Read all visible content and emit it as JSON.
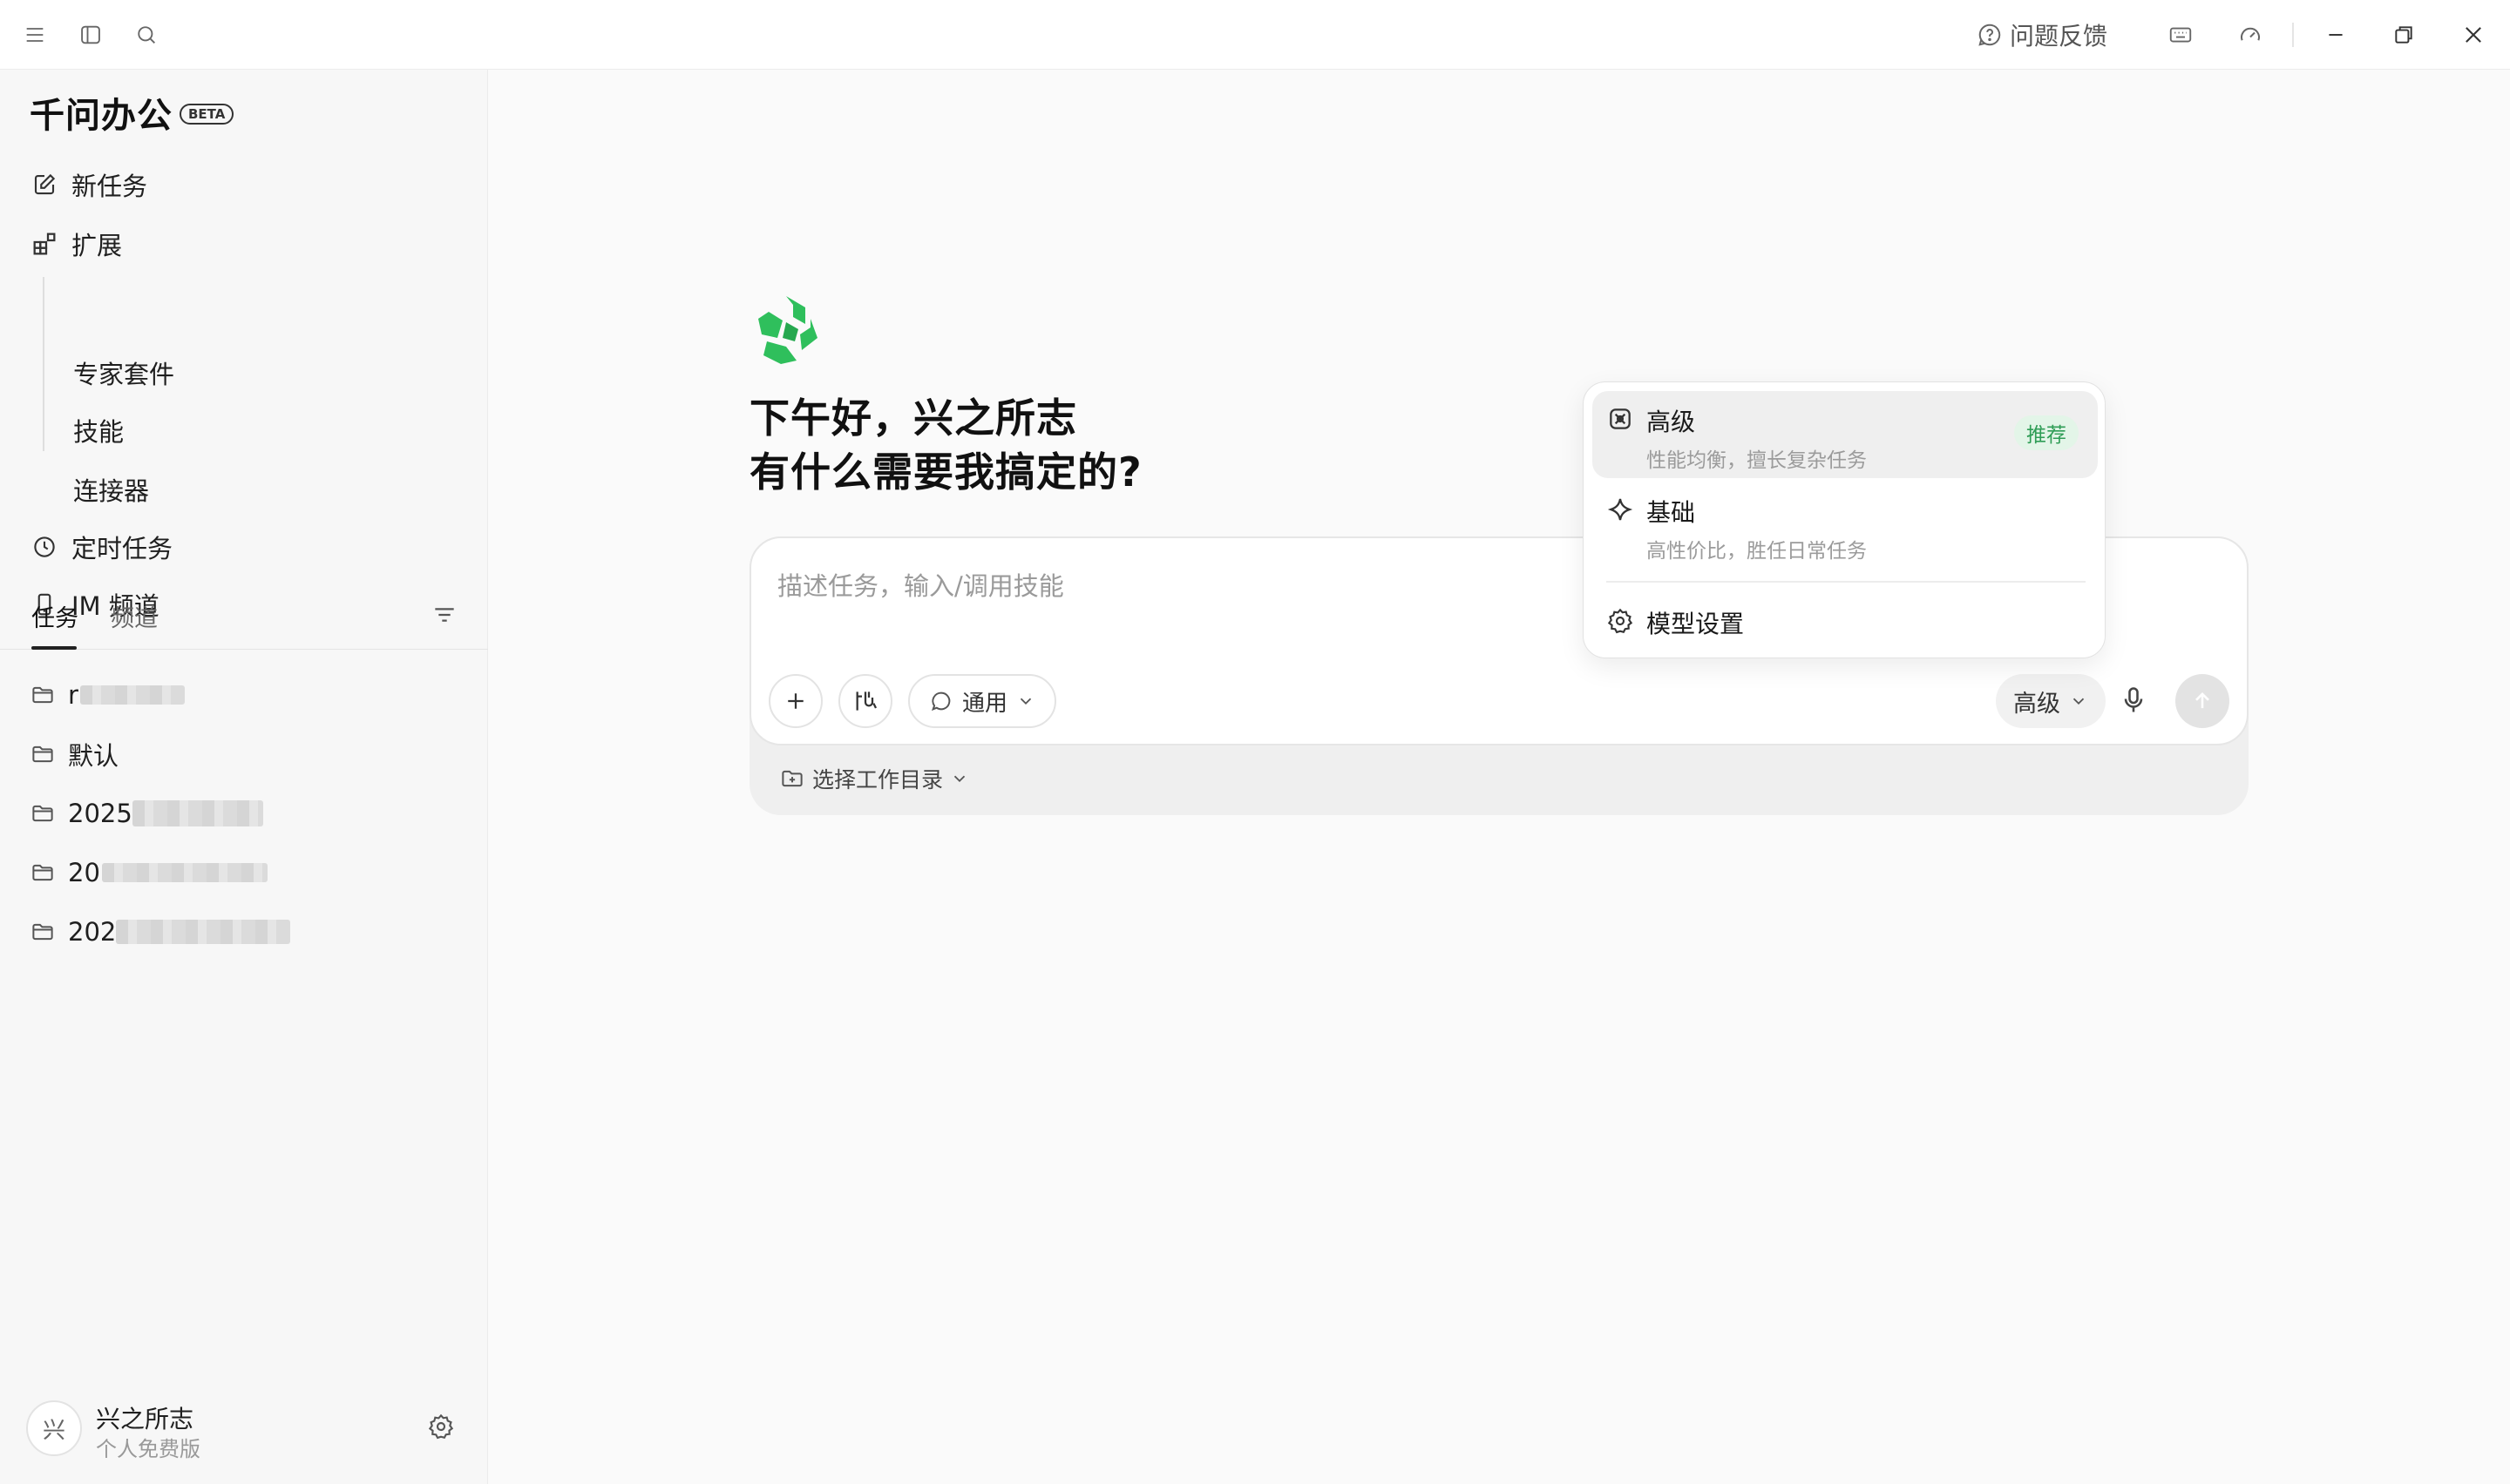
{
  "titlebar": {
    "feedback_label": "问题反馈",
    "icons": [
      "menu-icon",
      "sidebar-toggle-icon",
      "search-icon",
      "question-icon",
      "keyboard-icon",
      "speed-icon",
      "minimize-icon",
      "restore-icon",
      "close-icon"
    ]
  },
  "sidebar": {
    "brand": "千问办公",
    "badge": "BETA",
    "nav": {
      "new_task": "新任务",
      "extensions": "扩展",
      "expert_suite": "专家套件",
      "skills": "技能",
      "connectors": "连接器",
      "scheduled": "定时任务",
      "im_channel": "IM 频道"
    },
    "tabs": {
      "tasks": "任务",
      "channels": "频道"
    },
    "folders": [
      "r",
      "默认",
      "2025",
      "20",
      "202"
    ],
    "user": {
      "avatar": "兴",
      "name": "兴之所志",
      "plan": "个人免费版"
    }
  },
  "main": {
    "greeting_line1": "下午好，兴之所志",
    "greeting_line2": "有什么需要我搞定的?",
    "input_placeholder": "描述任务，输入/调用技能",
    "mode_label": "通用",
    "model_label": "高级",
    "workdir_label": "选择工作目录"
  },
  "menu": {
    "advanced": {
      "title": "高级",
      "desc": "性能均衡，擅长复杂任务",
      "badge": "推荐"
    },
    "basic": {
      "title": "基础",
      "desc": "高性价比，胜任日常任务"
    },
    "settings": "模型设置"
  },
  "colors": {
    "accent_green": "#2fbf5c",
    "badge_bg": "#e3f5e8",
    "badge_text": "#2f9d56"
  }
}
